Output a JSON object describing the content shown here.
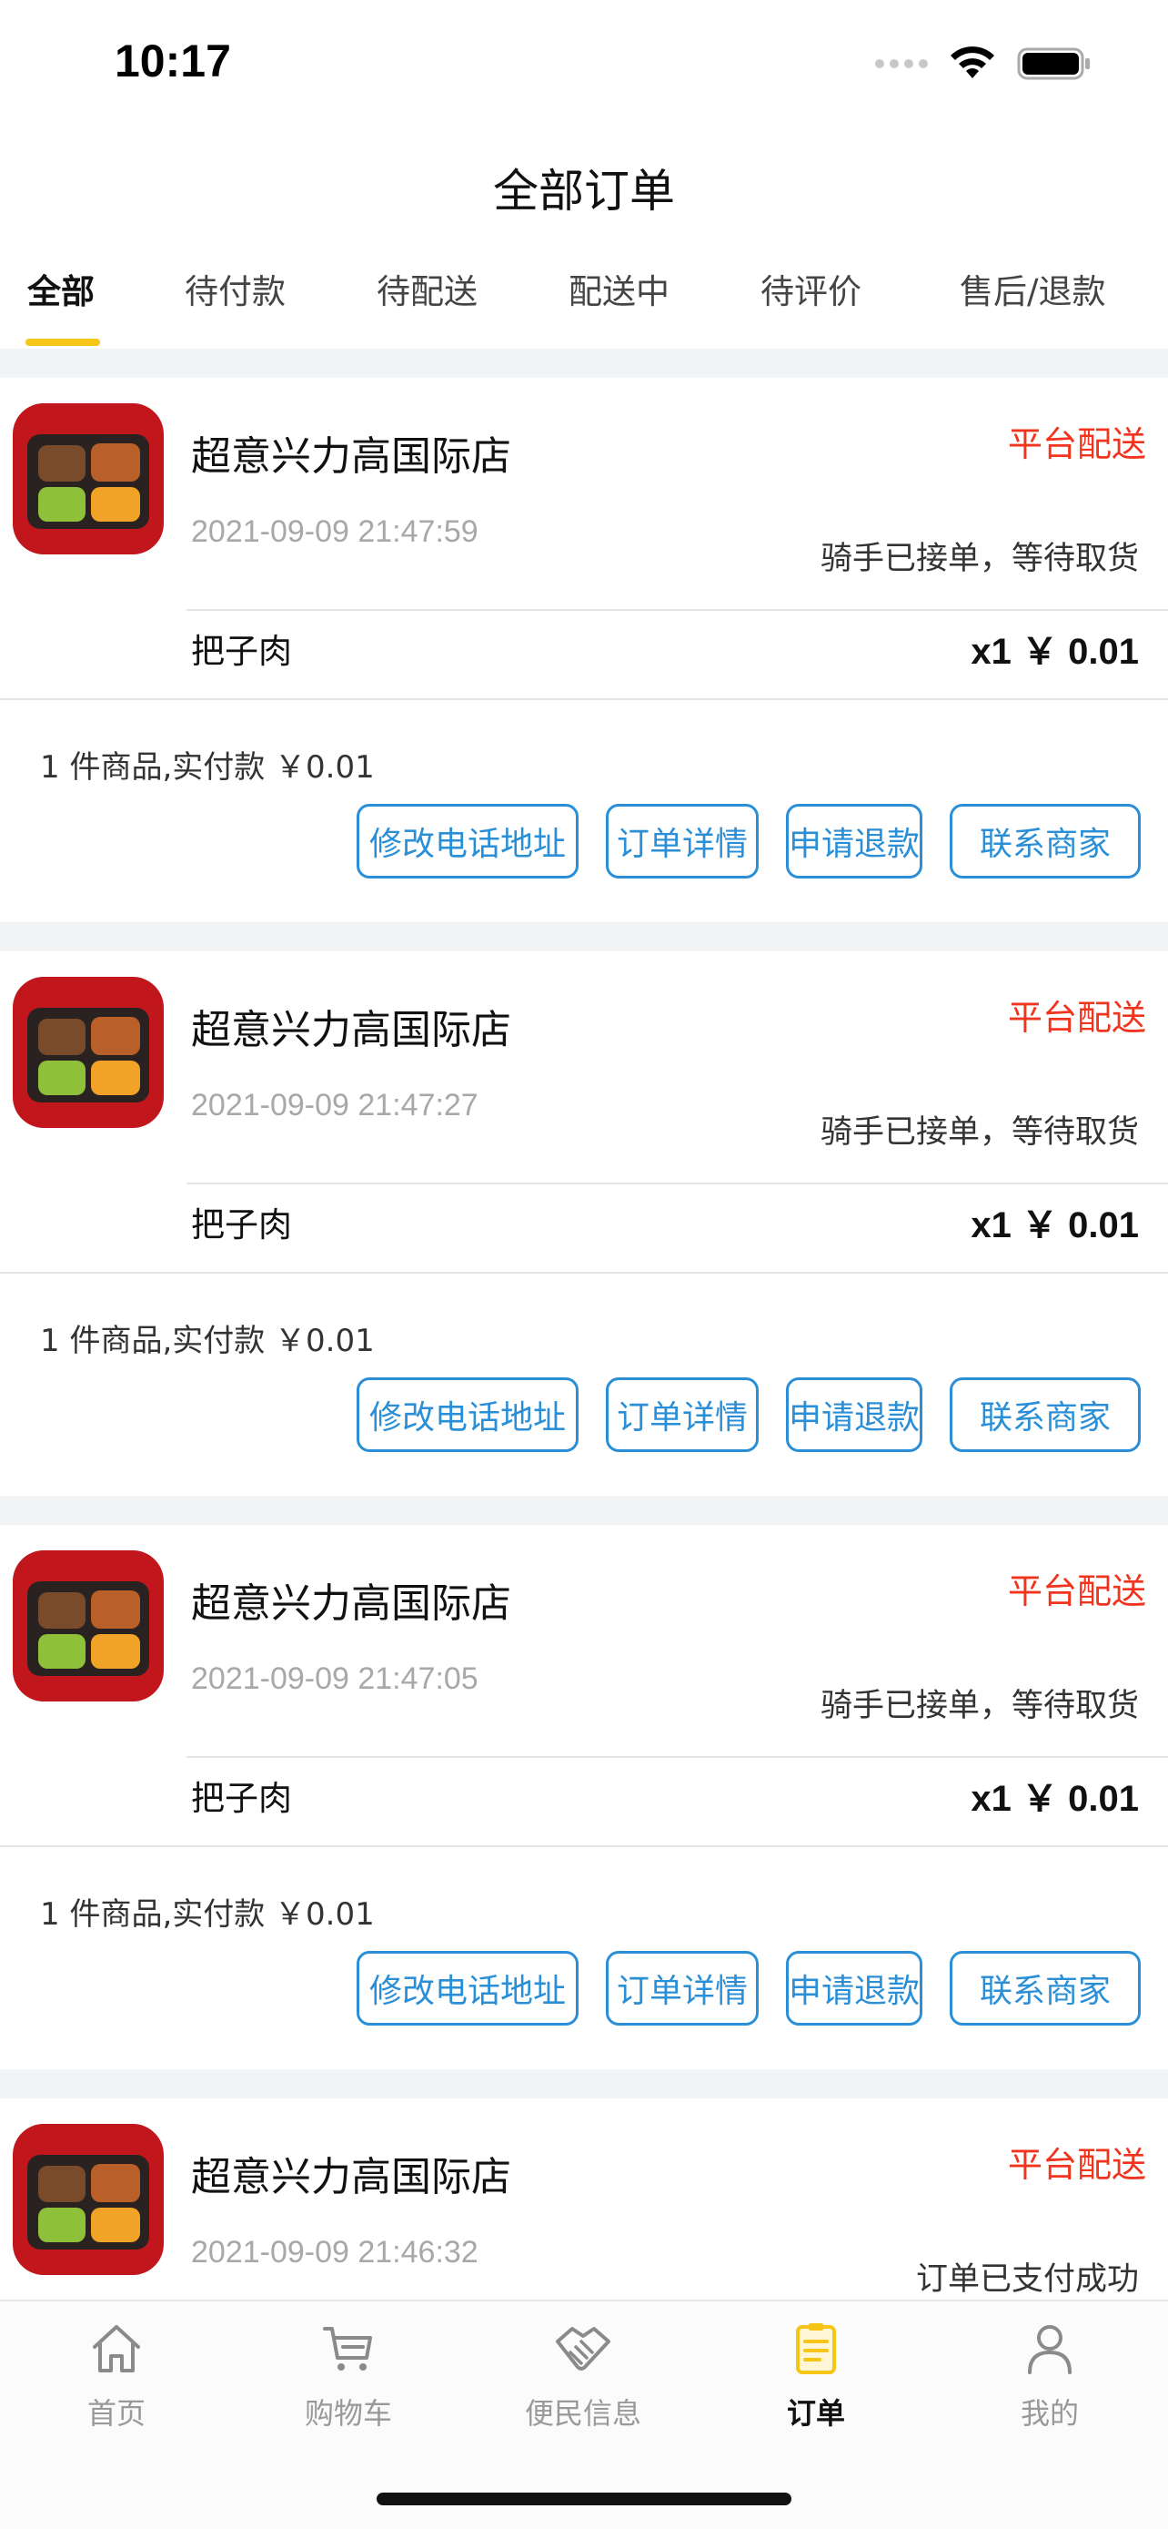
{
  "status_bar": {
    "time": "10:17",
    "icons": [
      "signal-dots-icon",
      "wifi-icon",
      "battery-icon"
    ]
  },
  "header": {
    "title": "全部订单"
  },
  "tabs": [
    {
      "label": "全部",
      "active": true
    },
    {
      "label": "待付款",
      "active": false
    },
    {
      "label": "待配送",
      "active": false
    },
    {
      "label": "配送中",
      "active": false
    },
    {
      "label": "待评价",
      "active": false
    },
    {
      "label": "售后/退款",
      "active": false
    }
  ],
  "orders": [
    {
      "shop_name": "超意兴力高国际店",
      "delivery_type": "平台配送",
      "time": "2021-09-09 21:47:59",
      "status": "骑手已接单，等待取货",
      "item_name": "把子肉",
      "item_price": "x1 ￥ 0.01",
      "summary": "1 件商品,实付款 ￥0.01",
      "buttons": [
        "修改电话地址",
        "订单详情",
        "申请退款",
        "联系商家"
      ]
    },
    {
      "shop_name": "超意兴力高国际店",
      "delivery_type": "平台配送",
      "time": "2021-09-09 21:47:27",
      "status": "骑手已接单，等待取货",
      "item_name": "把子肉",
      "item_price": "x1 ￥ 0.01",
      "summary": "1 件商品,实付款 ￥0.01",
      "buttons": [
        "修改电话地址",
        "订单详情",
        "申请退款",
        "联系商家"
      ]
    },
    {
      "shop_name": "超意兴力高国际店",
      "delivery_type": "平台配送",
      "time": "2021-09-09 21:47:05",
      "status": "骑手已接单，等待取货",
      "item_name": "把子肉",
      "item_price": "x1 ￥ 0.01",
      "summary": "1 件商品,实付款 ￥0.01",
      "buttons": [
        "修改电话地址",
        "订单详情",
        "申请退款",
        "联系商家"
      ]
    },
    {
      "shop_name": "超意兴力高国际店",
      "delivery_type": "平台配送",
      "time": "2021-09-09 21:46:32",
      "status": "订单已支付成功"
    }
  ],
  "tabbar": [
    {
      "label": "首页",
      "icon": "home-icon",
      "active": false
    },
    {
      "label": "购物车",
      "icon": "cart-icon",
      "active": false
    },
    {
      "label": "便民信息",
      "icon": "handshake-icon",
      "active": false
    },
    {
      "label": "订单",
      "icon": "order-list-icon",
      "active": true
    },
    {
      "label": "我的",
      "icon": "profile-icon",
      "active": false
    }
  ],
  "colors": {
    "accent_yellow": "#f5c518",
    "delivery_red": "#f0341d",
    "button_blue": "#2a8fd6"
  }
}
